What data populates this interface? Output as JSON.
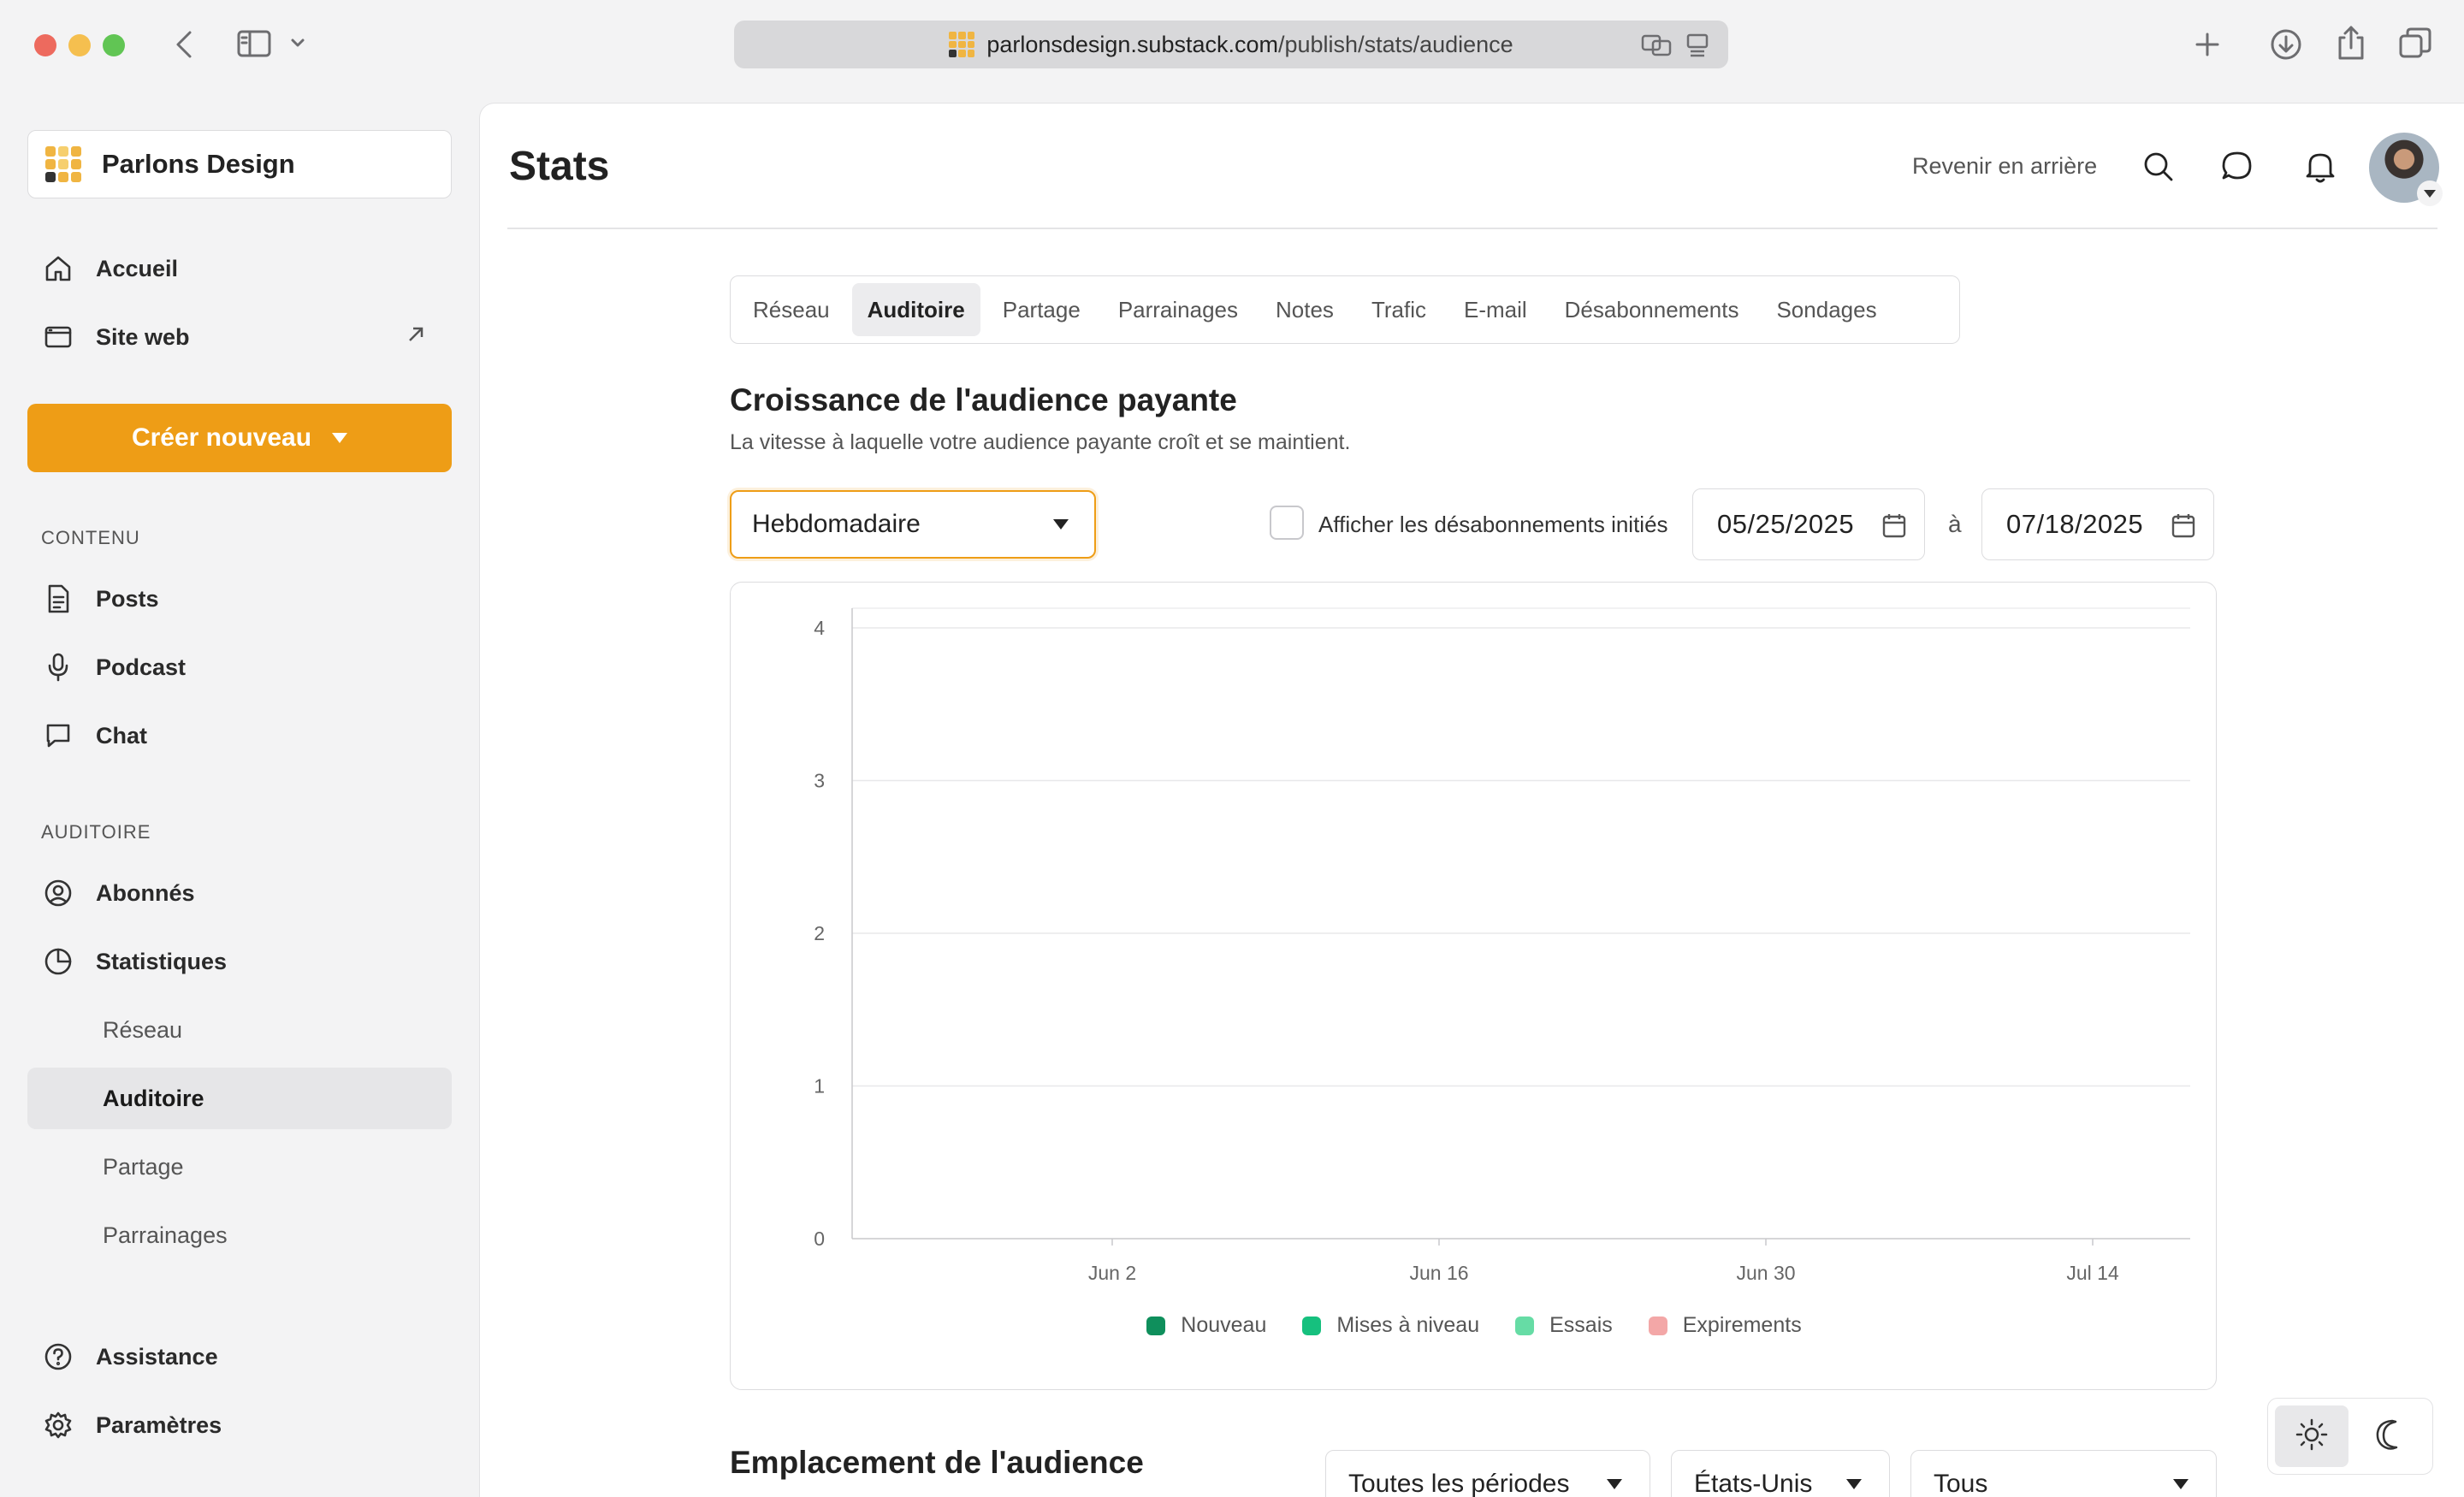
{
  "browser": {
    "url_host": "parlonsdesign.substack.com",
    "url_path": "/publish/stats/audience"
  },
  "sidebar": {
    "brand": "Parlons Design",
    "top_items": [
      {
        "label": "Accueil",
        "icon": "home-icon"
      },
      {
        "label": "Site web",
        "icon": "monitor-icon"
      }
    ],
    "create_button": "Créer nouveau",
    "content_section": "CONTENU",
    "content_items": [
      {
        "label": "Posts",
        "icon": "document-icon"
      },
      {
        "label": "Podcast",
        "icon": "microphone-icon"
      },
      {
        "label": "Chat",
        "icon": "chat-icon"
      }
    ],
    "audience_section": "AUDITOIRE",
    "audience_items": [
      {
        "label": "Abonnés",
        "icon": "user-circle-icon"
      },
      {
        "label": "Statistiques",
        "icon": "pie-chart-icon"
      }
    ],
    "stats_subitems": [
      "Réseau",
      "Auditoire",
      "Partage",
      "Parrainages"
    ],
    "stats_active": "Auditoire",
    "bottom_items": [
      {
        "label": "Assistance",
        "icon": "help-icon"
      },
      {
        "label": "Paramètres",
        "icon": "gear-icon"
      }
    ]
  },
  "header": {
    "title": "Stats",
    "back_link": "Revenir en arrière"
  },
  "tabs": [
    "Réseau",
    "Auditoire",
    "Partage",
    "Parrainages",
    "Notes",
    "Trafic",
    "E-mail",
    "Désabonnements",
    "Sondages"
  ],
  "active_tab": "Auditoire",
  "growth": {
    "title": "Croissance de l'audience payante",
    "description": "La vitesse à laquelle votre audience payante croît et se maintient.",
    "period_select": "Hebdomadaire",
    "checkbox_label": "Afficher les désabonnements initiés",
    "checkbox_checked": false,
    "date_from": "05/25/2025",
    "date_separator": "à",
    "date_to": "07/18/2025"
  },
  "chart_data": {
    "type": "bar",
    "x_tick_labels": [
      "Jun 2",
      "Jun 16",
      "Jun 30",
      "Jul 14"
    ],
    "y_ticks": [
      0,
      1,
      2,
      3,
      4
    ],
    "ylim": [
      0,
      4
    ],
    "grid": true,
    "legend_position": "bottom-center",
    "series": [
      {
        "name": "Nouveau",
        "color": "#0f8f5c",
        "values": [
          0,
          0,
          0,
          0
        ]
      },
      {
        "name": "Mises à niveau",
        "color": "#16c07e",
        "values": [
          0,
          0,
          0,
          0
        ]
      },
      {
        "name": "Essais",
        "color": "#66dca5",
        "values": [
          0,
          0,
          0,
          0
        ]
      },
      {
        "name": "Expirements",
        "color": "#f3a7a7",
        "values": [
          0,
          0,
          0,
          0
        ]
      }
    ]
  },
  "location": {
    "title": "Emplacement de l'audience",
    "period": "Toutes les périodes",
    "country": "États-Unis",
    "filter": "Tous"
  },
  "colors": {
    "accent": "#ee9d16"
  }
}
